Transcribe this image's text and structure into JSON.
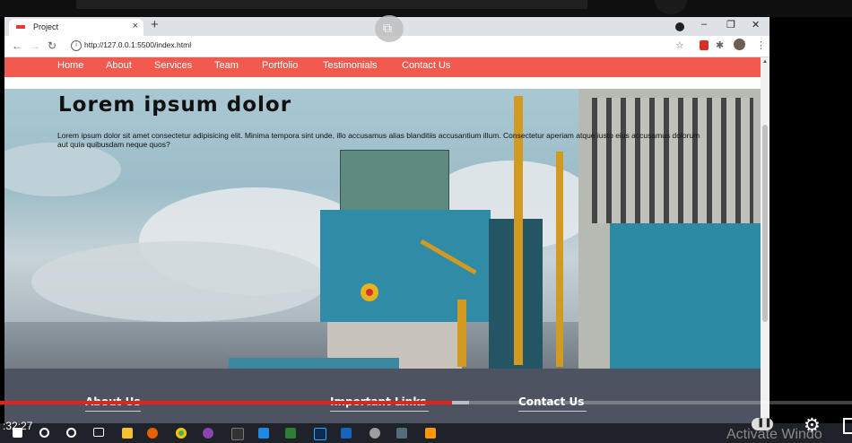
{
  "browser": {
    "tab_title": "Project",
    "tab_close": "×",
    "new_tab": "+",
    "window_controls": {
      "minimize": "–",
      "restore": "❐",
      "close": "✕"
    },
    "url": "http://127.0.0.1:5500/index.html",
    "icons": [
      "back-icon",
      "forward-icon",
      "reload-icon",
      "info-icon",
      "star-icon",
      "pdf-icon",
      "extensions-icon",
      "avatar",
      "menu-icon"
    ]
  },
  "site": {
    "nav": [
      "Home",
      "About",
      "Services",
      "Team",
      "Portfolio",
      "Testimonials",
      "Contact Us"
    ],
    "hero": {
      "title": "Lorem ipsum dolor",
      "text": "Lorem ipsum dolor sit amet consectetur adipisicing elit. Minima tempora sint unde, illo accusamus alias blanditiis accusantium illum. Consectetur aperiam atque iusto eius accusamus dolorum aut quia quibusdam neque quos?"
    },
    "footer": {
      "about_title": "About Us",
      "links_title": "Important Links",
      "contact_title": "Contact Us"
    },
    "accent": "#f05a4f",
    "footer_bg": "#4d5360"
  },
  "player": {
    "timestamp": ":32:27",
    "progress_fraction": 0.53,
    "buffer_fraction": 0.55,
    "progress_color": "#e62117",
    "watermark": "Activate Windo"
  },
  "taskbar": {
    "icons": [
      "windows-icon",
      "search-icon",
      "cortana-icon",
      "task-view-icon",
      "file-explorer-icon",
      "firefox-icon",
      "chrome-icon",
      "obs-icon",
      "app-icon",
      "vscode-icon",
      "app-icon-2",
      "photoshop-icon",
      "app-icon-3",
      "app-icon-4",
      "sublime-icon"
    ]
  }
}
